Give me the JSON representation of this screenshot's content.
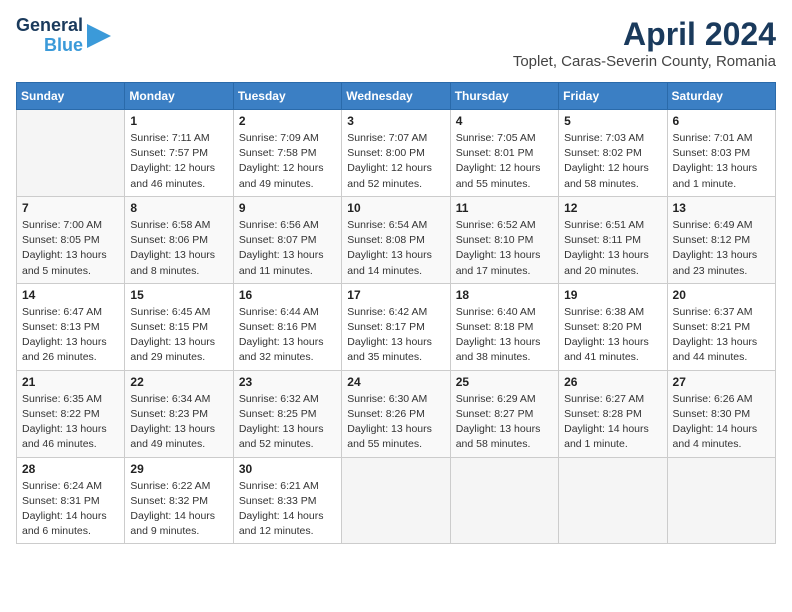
{
  "header": {
    "logo_line1": "General",
    "logo_line2": "Blue",
    "month_title": "April 2024",
    "location": "Toplet, Caras-Severin County, Romania"
  },
  "weekdays": [
    "Sunday",
    "Monday",
    "Tuesday",
    "Wednesday",
    "Thursday",
    "Friday",
    "Saturday"
  ],
  "weeks": [
    [
      {
        "day": "",
        "info": ""
      },
      {
        "day": "1",
        "info": "Sunrise: 7:11 AM\nSunset: 7:57 PM\nDaylight: 12 hours\nand 46 minutes."
      },
      {
        "day": "2",
        "info": "Sunrise: 7:09 AM\nSunset: 7:58 PM\nDaylight: 12 hours\nand 49 minutes."
      },
      {
        "day": "3",
        "info": "Sunrise: 7:07 AM\nSunset: 8:00 PM\nDaylight: 12 hours\nand 52 minutes."
      },
      {
        "day": "4",
        "info": "Sunrise: 7:05 AM\nSunset: 8:01 PM\nDaylight: 12 hours\nand 55 minutes."
      },
      {
        "day": "5",
        "info": "Sunrise: 7:03 AM\nSunset: 8:02 PM\nDaylight: 12 hours\nand 58 minutes."
      },
      {
        "day": "6",
        "info": "Sunrise: 7:01 AM\nSunset: 8:03 PM\nDaylight: 13 hours\nand 1 minute."
      }
    ],
    [
      {
        "day": "7",
        "info": "Sunrise: 7:00 AM\nSunset: 8:05 PM\nDaylight: 13 hours\nand 5 minutes."
      },
      {
        "day": "8",
        "info": "Sunrise: 6:58 AM\nSunset: 8:06 PM\nDaylight: 13 hours\nand 8 minutes."
      },
      {
        "day": "9",
        "info": "Sunrise: 6:56 AM\nSunset: 8:07 PM\nDaylight: 13 hours\nand 11 minutes."
      },
      {
        "day": "10",
        "info": "Sunrise: 6:54 AM\nSunset: 8:08 PM\nDaylight: 13 hours\nand 14 minutes."
      },
      {
        "day": "11",
        "info": "Sunrise: 6:52 AM\nSunset: 8:10 PM\nDaylight: 13 hours\nand 17 minutes."
      },
      {
        "day": "12",
        "info": "Sunrise: 6:51 AM\nSunset: 8:11 PM\nDaylight: 13 hours\nand 20 minutes."
      },
      {
        "day": "13",
        "info": "Sunrise: 6:49 AM\nSunset: 8:12 PM\nDaylight: 13 hours\nand 23 minutes."
      }
    ],
    [
      {
        "day": "14",
        "info": "Sunrise: 6:47 AM\nSunset: 8:13 PM\nDaylight: 13 hours\nand 26 minutes."
      },
      {
        "day": "15",
        "info": "Sunrise: 6:45 AM\nSunset: 8:15 PM\nDaylight: 13 hours\nand 29 minutes."
      },
      {
        "day": "16",
        "info": "Sunrise: 6:44 AM\nSunset: 8:16 PM\nDaylight: 13 hours\nand 32 minutes."
      },
      {
        "day": "17",
        "info": "Sunrise: 6:42 AM\nSunset: 8:17 PM\nDaylight: 13 hours\nand 35 minutes."
      },
      {
        "day": "18",
        "info": "Sunrise: 6:40 AM\nSunset: 8:18 PM\nDaylight: 13 hours\nand 38 minutes."
      },
      {
        "day": "19",
        "info": "Sunrise: 6:38 AM\nSunset: 8:20 PM\nDaylight: 13 hours\nand 41 minutes."
      },
      {
        "day": "20",
        "info": "Sunrise: 6:37 AM\nSunset: 8:21 PM\nDaylight: 13 hours\nand 44 minutes."
      }
    ],
    [
      {
        "day": "21",
        "info": "Sunrise: 6:35 AM\nSunset: 8:22 PM\nDaylight: 13 hours\nand 46 minutes."
      },
      {
        "day": "22",
        "info": "Sunrise: 6:34 AM\nSunset: 8:23 PM\nDaylight: 13 hours\nand 49 minutes."
      },
      {
        "day": "23",
        "info": "Sunrise: 6:32 AM\nSunset: 8:25 PM\nDaylight: 13 hours\nand 52 minutes."
      },
      {
        "day": "24",
        "info": "Sunrise: 6:30 AM\nSunset: 8:26 PM\nDaylight: 13 hours\nand 55 minutes."
      },
      {
        "day": "25",
        "info": "Sunrise: 6:29 AM\nSunset: 8:27 PM\nDaylight: 13 hours\nand 58 minutes."
      },
      {
        "day": "26",
        "info": "Sunrise: 6:27 AM\nSunset: 8:28 PM\nDaylight: 14 hours\nand 1 minute."
      },
      {
        "day": "27",
        "info": "Sunrise: 6:26 AM\nSunset: 8:30 PM\nDaylight: 14 hours\nand 4 minutes."
      }
    ],
    [
      {
        "day": "28",
        "info": "Sunrise: 6:24 AM\nSunset: 8:31 PM\nDaylight: 14 hours\nand 6 minutes."
      },
      {
        "day": "29",
        "info": "Sunrise: 6:22 AM\nSunset: 8:32 PM\nDaylight: 14 hours\nand 9 minutes."
      },
      {
        "day": "30",
        "info": "Sunrise: 6:21 AM\nSunset: 8:33 PM\nDaylight: 14 hours\nand 12 minutes."
      },
      {
        "day": "",
        "info": ""
      },
      {
        "day": "",
        "info": ""
      },
      {
        "day": "",
        "info": ""
      },
      {
        "day": "",
        "info": ""
      }
    ]
  ]
}
